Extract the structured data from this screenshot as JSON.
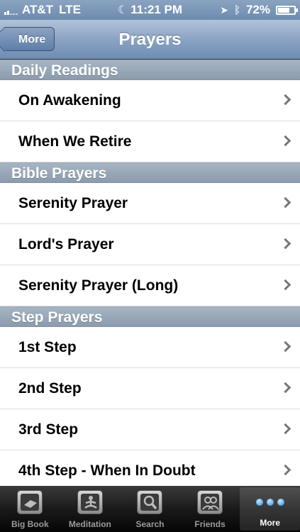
{
  "status_bar": {
    "carrier": "AT&T",
    "network": "LTE",
    "time": "11:21 PM",
    "battery_percent": "72%",
    "battery_level": 0.72
  },
  "nav": {
    "back_label": "More",
    "title": "Prayers"
  },
  "sections": [
    {
      "header": "Daily Readings",
      "items": [
        "On Awakening",
        "When We Retire"
      ]
    },
    {
      "header": "Bible Prayers",
      "items": [
        "Serenity Prayer",
        "Lord's Prayer",
        "Serenity Prayer (Long)"
      ]
    },
    {
      "header": "Step Prayers",
      "items": [
        "1st Step",
        "2nd Step",
        "3rd Step",
        "4th Step - When In Doubt"
      ]
    }
  ],
  "tabs": [
    {
      "label": "Big Book",
      "icon": "book-icon"
    },
    {
      "label": "Meditation",
      "icon": "meditation-icon"
    },
    {
      "label": "Search",
      "icon": "search-icon"
    },
    {
      "label": "Friends",
      "icon": "friends-icon"
    },
    {
      "label": "More",
      "icon": "more-dots-icon"
    }
  ],
  "colors": {
    "nav_bar": "#8ba3c3",
    "section_header": "#98a7b8",
    "tab_bar": "#1a1a1a",
    "active_tab_icon": "#1f8be6"
  }
}
